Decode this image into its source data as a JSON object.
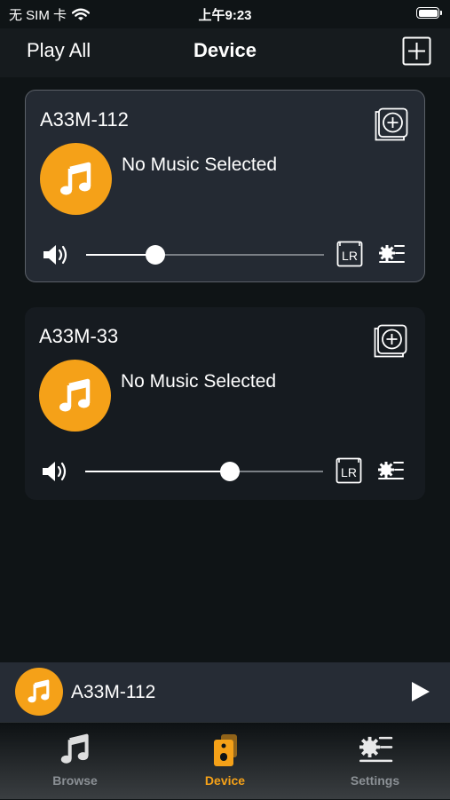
{
  "status_bar": {
    "carrier": "无 SIM 卡",
    "time": "上午9:23"
  },
  "header": {
    "left_label": "Play All",
    "title": "Device",
    "add_icon": "plus-square-icon"
  },
  "devices": [
    {
      "name": "A33M-112",
      "status": "No Music Selected",
      "volume_fraction": 0.29,
      "selected": true
    },
    {
      "name": "A33M-33",
      "status": "No Music Selected",
      "volume_fraction": 0.61,
      "selected": false
    }
  ],
  "mini_player": {
    "name": "A33M-112",
    "control": "play-icon"
  },
  "tabs": [
    {
      "label": "Browse",
      "icon": "music-note-icon",
      "active": false
    },
    {
      "label": "Device",
      "icon": "speaker-device-icon",
      "active": true
    },
    {
      "label": "Settings",
      "icon": "settings-icon",
      "active": false
    }
  ],
  "colors": {
    "accent": "#f5a118",
    "background": "#0f1416",
    "card_selected": "#242a33",
    "card": "#161b20",
    "mini_player": "#262c35"
  }
}
